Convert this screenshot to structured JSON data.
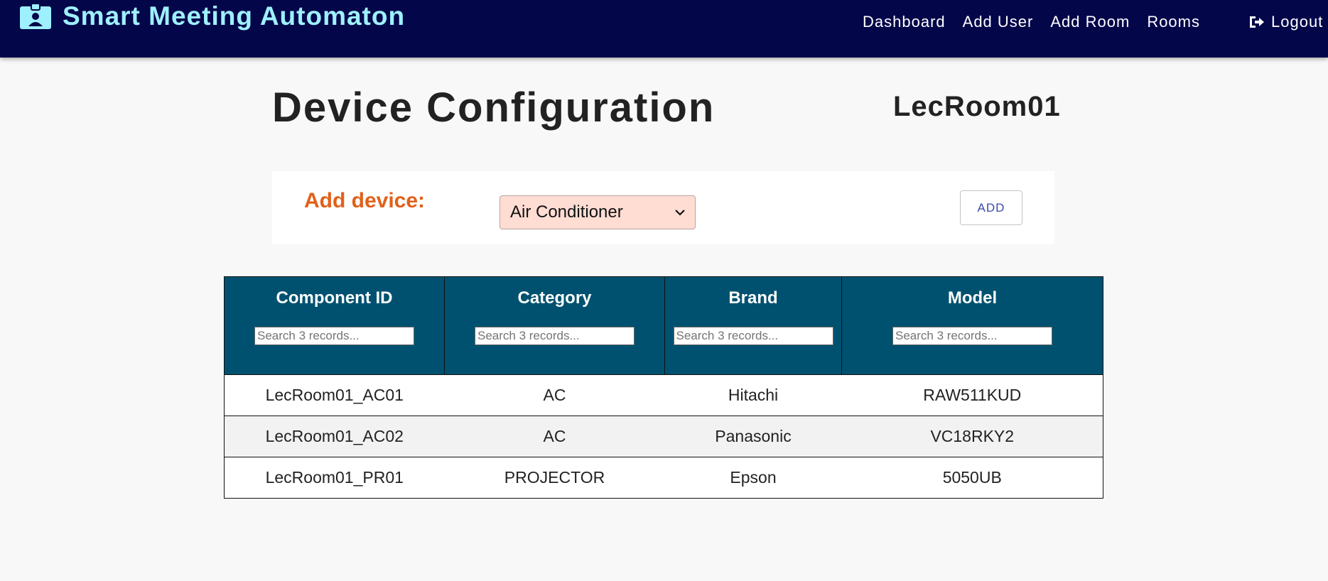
{
  "navbar": {
    "brand": "Smart Meeting Automaton",
    "links": [
      "Dashboard",
      "Add User",
      "Add Room",
      "Rooms"
    ],
    "logout": "Logout",
    "background": "#04064a",
    "brand_color": "#9ef0ff"
  },
  "page": {
    "title": "Device Configuration",
    "room": "LecRoom01"
  },
  "add_device": {
    "label": "Add device:",
    "selected": "Air Conditioner",
    "button": "ADD",
    "label_color": "#e0611a",
    "select_bg": "#ffddd3"
  },
  "table": {
    "header_bg": "#00516f",
    "columns": [
      {
        "label": "Component ID",
        "search_placeholder": "Search 3 records..."
      },
      {
        "label": "Category",
        "search_placeholder": "Search 3 records..."
      },
      {
        "label": "Brand",
        "search_placeholder": "Search 3 records..."
      },
      {
        "label": "Model",
        "search_placeholder": "Search 3 records..."
      }
    ],
    "rows": [
      [
        "LecRoom01_AC01",
        "AC",
        "Hitachi",
        "RAW511KUD"
      ],
      [
        "LecRoom01_AC02",
        "AC",
        "Panasonic",
        "VC18RKY2"
      ],
      [
        "LecRoom01_PR01",
        "PROJECTOR",
        "Epson",
        "5050UB"
      ]
    ]
  },
  "icons": {
    "brand": "id-badge-icon",
    "logout": "sign-out-icon",
    "select": "chevron-down-icon"
  }
}
